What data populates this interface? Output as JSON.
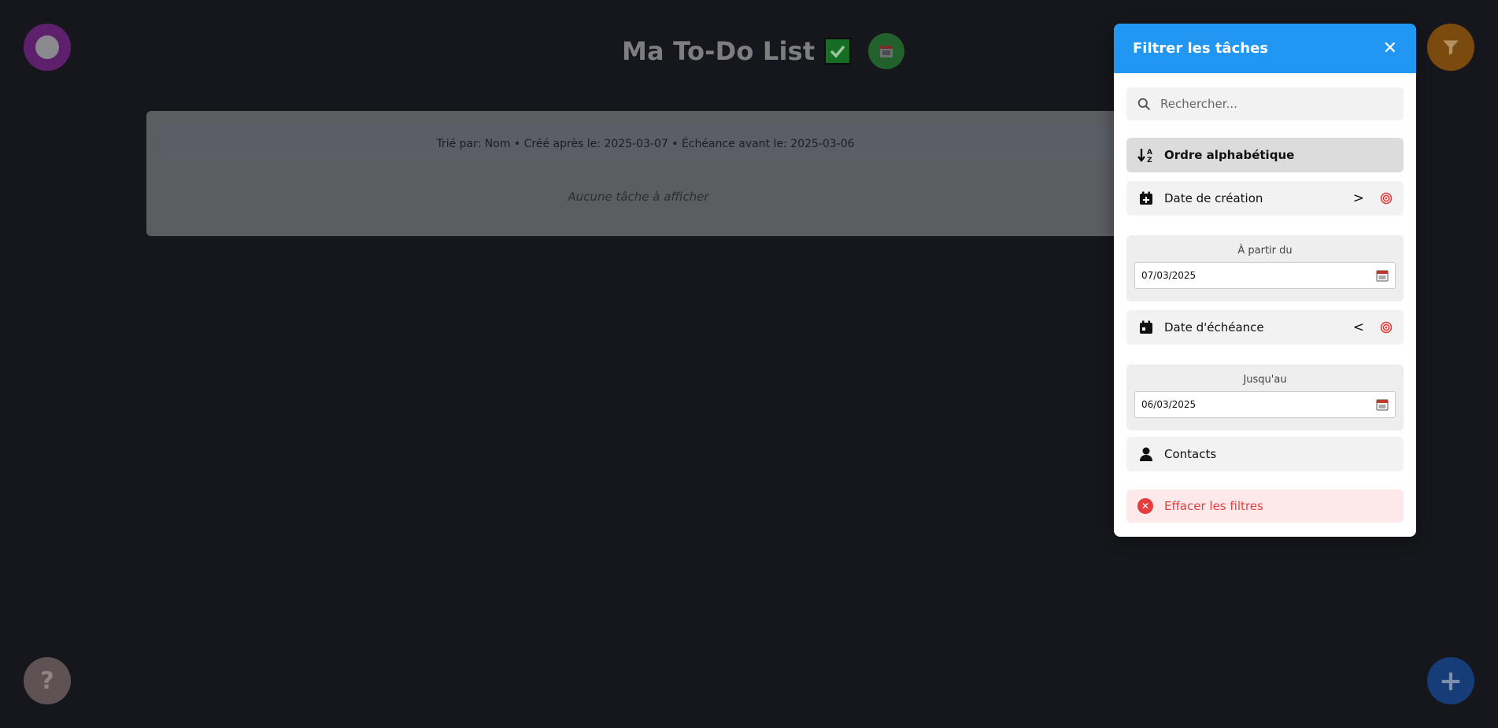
{
  "app": {
    "title": "Ma To-Do List",
    "help_label": "?",
    "add_label": "+"
  },
  "tasks": {
    "summary": "Trié par: Nom • Créé après le: 2025-03-07 • Échéance avant le: 2025-03-06",
    "empty_text": "Aucune tâche à afficher"
  },
  "filter_panel": {
    "title": "Filtrer les tâches",
    "close_label": "✕",
    "search_placeholder": "Rechercher...",
    "sort_alpha": "Ordre alphabétique",
    "creation": {
      "label": "Date de création",
      "operator": ">",
      "date_label": "À partir du",
      "date_value": "07/03/2025"
    },
    "due": {
      "label": "Date d'échéance",
      "operator": "<",
      "date_label": "Jusqu'au",
      "date_value": "06/03/2025"
    },
    "contacts": "Contacts",
    "clear_label": "Effacer les filtres"
  },
  "colors": {
    "accent": "#2196f3",
    "danger": "#e53e3e",
    "background": "#16171c"
  }
}
